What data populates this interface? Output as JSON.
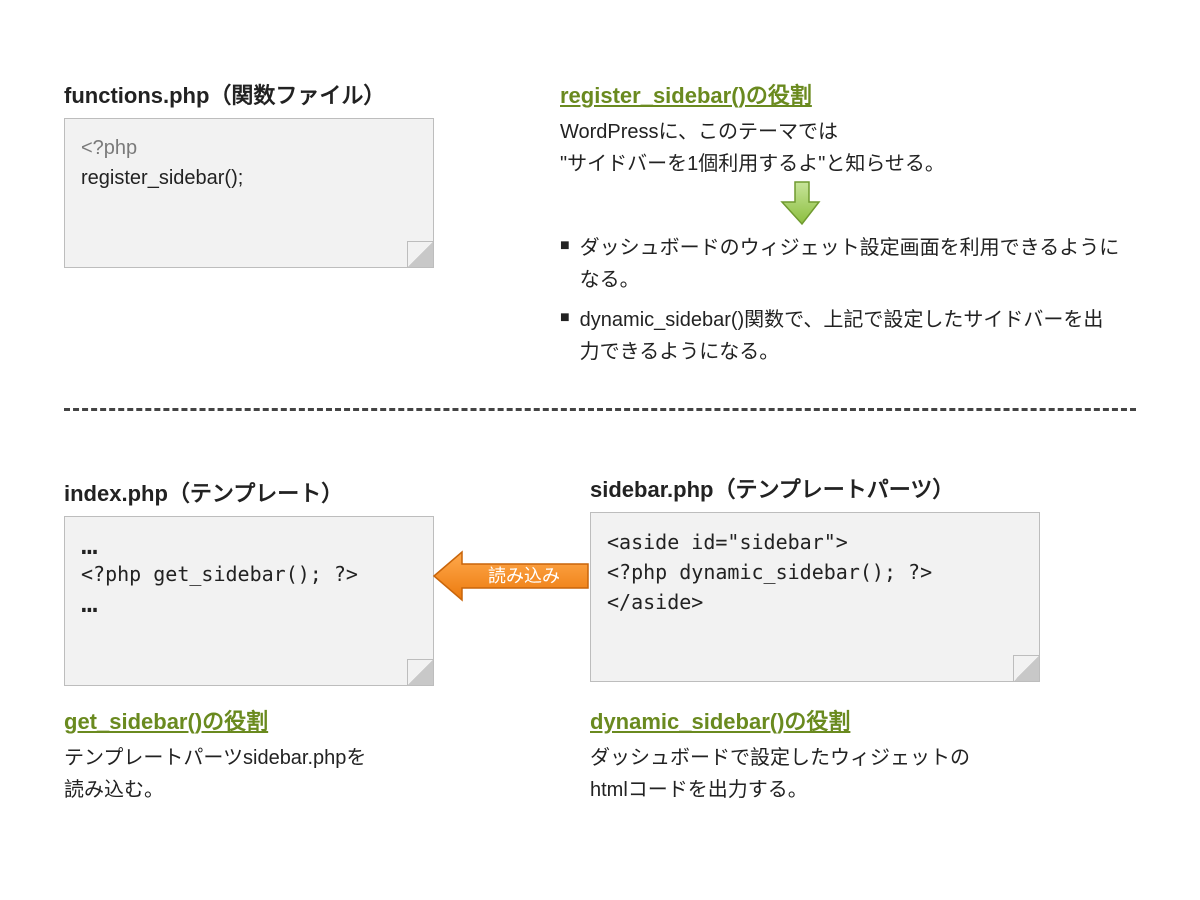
{
  "functions": {
    "title": "functions.php（関数ファイル）",
    "code_line1": "<?php",
    "code_line2": "register_sidebar();"
  },
  "register": {
    "title": "register_sidebar()の役割",
    "desc_line1": "WordPressに、このテーマでは",
    "desc_line2": "\"サイドバーを1個利用するよ\"と知らせる。",
    "bullets": [
      "ダッシュボードのウィジェット設定画面を利用できるようになる。",
      "dynamic_sidebar()関数で、上記で設定したサイドバーを出力できるようになる。"
    ]
  },
  "index": {
    "title": "index.php（テンプレート）",
    "code_line1": "…",
    "code_line2": "<?php get_sidebar(); ?>",
    "code_line3": "…"
  },
  "sidebar": {
    "title": "sidebar.php（テンプレートパーツ）",
    "code_line1": "<aside id=\"sidebar\">",
    "code_line2": "<?php dynamic_sidebar(); ?>",
    "code_line3": "</aside>"
  },
  "arrow_left_label": "読み込み",
  "get": {
    "title": "get_sidebar()の役割",
    "desc_line1": "テンプレートパーツsidebar.phpを",
    "desc_line2": "読み込む。"
  },
  "dyn": {
    "title": "dynamic_sidebar()の役割",
    "desc_line1": "ダッシュボードで設定したウィジェットの",
    "desc_line2": "htmlコードを出力する。"
  }
}
